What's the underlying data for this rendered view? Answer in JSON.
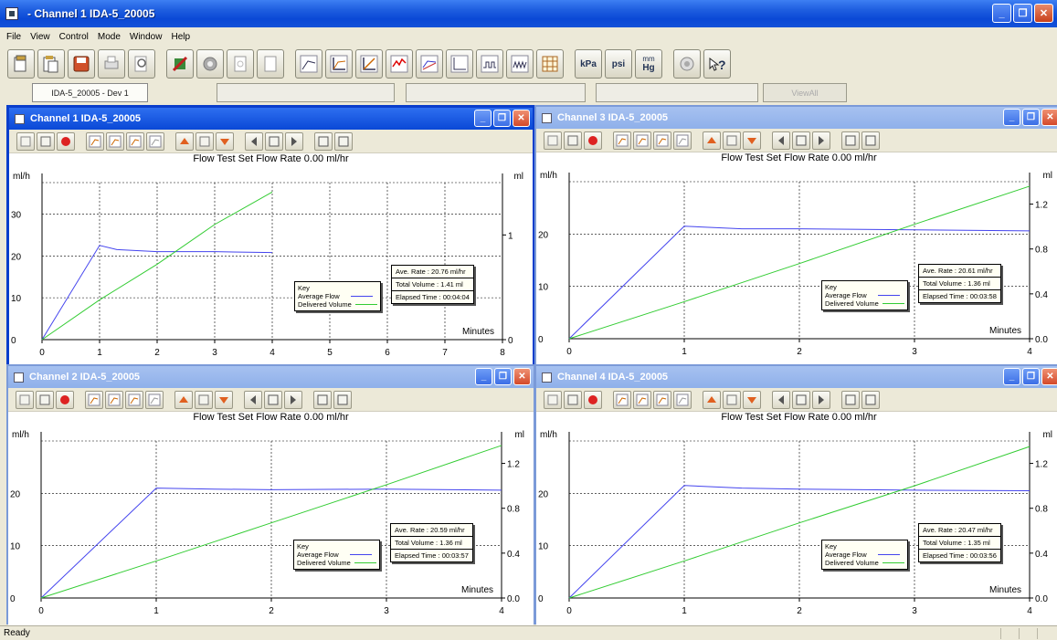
{
  "app": {
    "title": " - Channel 1 IDA-5_20005"
  },
  "menu": [
    "File",
    "View",
    "Control",
    "Mode",
    "Window",
    "Help"
  ],
  "toolbar": {
    "unit_kpa": "kPa",
    "unit_psi": "psi",
    "unit_mmhg_top": "mm",
    "unit_mmhg_bot": "Hg"
  },
  "tabs": [
    {
      "label": "IDA-5_20005 - Dev 1",
      "active": true
    },
    {
      "label": ""
    },
    {
      "label": ""
    },
    {
      "label": ""
    },
    {
      "label": "ViewAll",
      "dim": true
    }
  ],
  "status": {
    "text": "Ready"
  },
  "channels": [
    {
      "title": "Channel 1 IDA-5_20005",
      "heading": "Flow Test   Set Flow Rate 0.00 ml/hr",
      "left_unit": "ml/h",
      "right_unit": "ml",
      "x_label": "Minutes",
      "x_ticks": [
        "0",
        "1",
        "2",
        "3",
        "4",
        "5",
        "6",
        "7",
        "8"
      ],
      "y_ticks_left": [
        "0",
        "10",
        "20",
        "30"
      ],
      "y_ticks_right": [
        "0",
        "1"
      ],
      "key": {
        "title": "Key",
        "avg": "Average Flow",
        "vol": "Delivered Volume"
      },
      "stats": {
        "rate": "Ave. Rate : 20.76 ml/hr",
        "volume": "Total Volume : 1.41 ml",
        "elapsed": "Elapsed Time : 00:04:04"
      }
    },
    {
      "title": "Channel 3 IDA-5_20005",
      "heading": "Flow Test   Set Flow Rate 0.00 ml/hr",
      "left_unit": "ml/h",
      "right_unit": "ml",
      "x_label": "Minutes",
      "x_ticks": [
        "0",
        "1",
        "2",
        "3",
        "4"
      ],
      "y_ticks_left": [
        "0",
        "10",
        "20"
      ],
      "y_ticks_right": [
        "0.0",
        "0.4",
        "0.8",
        "1.2"
      ],
      "key": {
        "title": "Key",
        "avg": "Average Flow",
        "vol": "Delivered Volume"
      },
      "stats": {
        "rate": "Ave. Rate : 20.61 ml/hr",
        "volume": "Total Volume : 1.36 ml",
        "elapsed": "Elapsed Time : 00:03:58"
      }
    },
    {
      "title": "Channel 2 IDA-5_20005",
      "heading": "Flow Test   Set Flow Rate 0.00 ml/hr",
      "left_unit": "ml/h",
      "right_unit": "ml",
      "x_label": "Minutes",
      "x_ticks": [
        "0",
        "1",
        "2",
        "3",
        "4"
      ],
      "y_ticks_left": [
        "0",
        "10",
        "20"
      ],
      "y_ticks_right": [
        "0.0",
        "0.4",
        "0.8",
        "1.2"
      ],
      "key": {
        "title": "Key",
        "avg": "Average Flow",
        "vol": "Delivered Volume"
      },
      "stats": {
        "rate": "Ave. Rate : 20.59 ml/hr",
        "volume": "Total Volume : 1.36 ml",
        "elapsed": "Elapsed Time : 00:03:57"
      }
    },
    {
      "title": "Channel 4 IDA-5_20005",
      "heading": "Flow Test   Set Flow Rate 0.00 ml/hr",
      "left_unit": "ml/h",
      "right_unit": "ml",
      "x_label": "Minutes",
      "x_ticks": [
        "0",
        "1",
        "2",
        "3",
        "4"
      ],
      "y_ticks_left": [
        "0",
        "10",
        "20"
      ],
      "y_ticks_right": [
        "0.0",
        "0.4",
        "0.8",
        "1.2"
      ],
      "key": {
        "title": "Key",
        "avg": "Average Flow",
        "vol": "Delivered Volume"
      },
      "stats": {
        "rate": "Ave. Rate : 20.47 ml/hr",
        "volume": "Total Volume : 1.35 ml",
        "elapsed": "Elapsed Time : 00:03:56"
      }
    }
  ],
  "chart_data": [
    {
      "type": "line",
      "panel": "Channel 1 IDA-5_20005",
      "xlabel": "Minutes",
      "ylabel": "ml/h",
      "y2label": "ml",
      "xlim": [
        0,
        8
      ],
      "ylim": [
        0,
        37.5
      ],
      "y2lim": [
        0,
        1.5
      ],
      "grid": true,
      "legend": "Key box, lower right",
      "series": [
        {
          "name": "Average Flow",
          "axis": "left",
          "color": "#4444ee",
          "x": [
            0,
            1,
            1.3,
            2,
            3,
            4
          ],
          "y": [
            0,
            22.5,
            21.5,
            21,
            21,
            20.8
          ]
        },
        {
          "name": "Delivered Volume",
          "axis": "right",
          "color": "#33cc33",
          "x": [
            0,
            1,
            2,
            3,
            4
          ],
          "y": [
            0,
            0.38,
            0.72,
            1.1,
            1.41
          ]
        }
      ]
    },
    {
      "type": "line",
      "panel": "Channel 3 IDA-5_20005",
      "xlabel": "Minutes",
      "ylabel": "ml/h",
      "y2label": "ml",
      "xlim": [
        0,
        4
      ],
      "ylim": [
        0,
        30
      ],
      "y2lim": [
        0,
        1.4
      ],
      "grid": true,
      "legend": "Key box, lower right",
      "series": [
        {
          "name": "Average Flow",
          "axis": "left",
          "color": "#4444ee",
          "x": [
            0,
            1,
            1.5,
            2,
            3,
            4
          ],
          "y": [
            0,
            21.5,
            21,
            21,
            20.8,
            20.6
          ]
        },
        {
          "name": "Delivered Volume",
          "axis": "right",
          "color": "#33cc33",
          "x": [
            0,
            1,
            2,
            3,
            4
          ],
          "y": [
            0,
            0.33,
            0.67,
            1.02,
            1.36
          ]
        }
      ]
    },
    {
      "type": "line",
      "panel": "Channel 2 IDA-5_20005",
      "xlabel": "Minutes",
      "ylabel": "ml/h",
      "y2label": "ml",
      "xlim": [
        0,
        4
      ],
      "ylim": [
        0,
        30
      ],
      "y2lim": [
        0,
        1.4
      ],
      "grid": true,
      "legend": "Key box, lower right",
      "series": [
        {
          "name": "Average Flow",
          "axis": "left",
          "color": "#4444ee",
          "x": [
            0,
            1,
            1.5,
            2,
            3,
            4
          ],
          "y": [
            0,
            21,
            20.8,
            20.7,
            20.8,
            20.6
          ]
        },
        {
          "name": "Delivered Volume",
          "axis": "right",
          "color": "#33cc33",
          "x": [
            0,
            1,
            2,
            3,
            4
          ],
          "y": [
            0,
            0.33,
            0.67,
            1.01,
            1.36
          ]
        }
      ]
    },
    {
      "type": "line",
      "panel": "Channel 4 IDA-5_20005",
      "xlabel": "Minutes",
      "ylabel": "ml/h",
      "y2label": "ml",
      "xlim": [
        0,
        4
      ],
      "ylim": [
        0,
        30
      ],
      "y2lim": [
        0,
        1.4
      ],
      "grid": true,
      "legend": "Key box, lower right",
      "series": [
        {
          "name": "Average Flow",
          "axis": "left",
          "color": "#4444ee",
          "x": [
            0,
            1,
            1.5,
            2,
            3,
            4
          ],
          "y": [
            0,
            21.5,
            21,
            20.8,
            20.6,
            20.5
          ]
        },
        {
          "name": "Delivered Volume",
          "axis": "right",
          "color": "#33cc33",
          "x": [
            0,
            1,
            2,
            3,
            4
          ],
          "y": [
            0,
            0.33,
            0.67,
            1.0,
            1.35
          ]
        }
      ]
    }
  ]
}
